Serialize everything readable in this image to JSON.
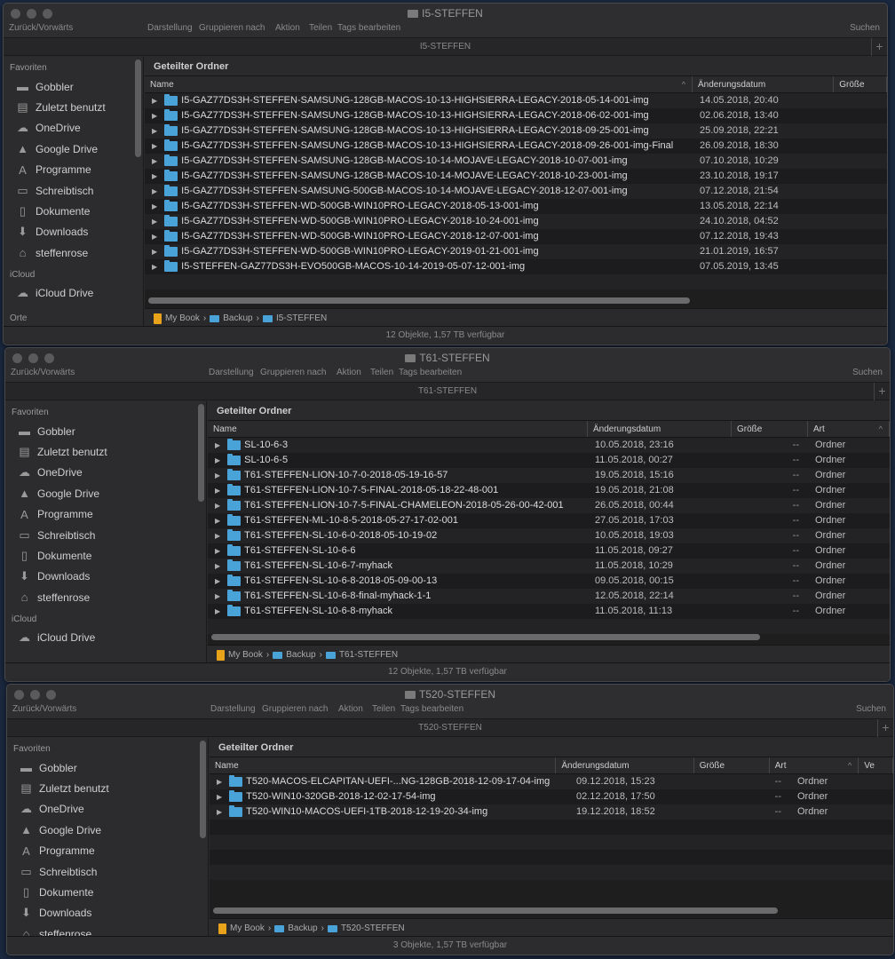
{
  "toolbar": {
    "back_forward": "Zurück/Vorwärts",
    "view": "Darstellung",
    "group": "Gruppieren nach",
    "action": "Aktion",
    "share": "Teilen",
    "tags": "Tags bearbeiten",
    "search": "Suchen"
  },
  "sidebar": {
    "favorites_label": "Favoriten",
    "items": [
      {
        "label": "Gobbler",
        "icon": "folder-icon"
      },
      {
        "label": "Zuletzt benutzt",
        "icon": "recents-icon"
      },
      {
        "label": "OneDrive",
        "icon": "cloud-icon"
      },
      {
        "label": "Google Drive",
        "icon": "google-drive-icon"
      },
      {
        "label": "Programme",
        "icon": "applications-icon"
      },
      {
        "label": "Schreibtisch",
        "icon": "desktop-icon"
      },
      {
        "label": "Dokumente",
        "icon": "documents-icon"
      },
      {
        "label": "Downloads",
        "icon": "downloads-icon"
      },
      {
        "label": "steffenrose",
        "icon": "home-icon"
      }
    ],
    "icloud_label": "iCloud",
    "icloud_drive": "iCloud Drive",
    "places_label": "Orte"
  },
  "columns": {
    "name": "Name",
    "date": "Änderungsdatum",
    "size": "Größe",
    "kind": "Art",
    "version": "Ve"
  },
  "group_header": "Geteilter Ordner",
  "colors": {
    "folder": "#4aa3d8",
    "drive": "#e8a31a",
    "desktop": "#1b2940"
  },
  "windows": [
    {
      "title": "I5-STEFFEN",
      "tab": "I5-STEFFEN",
      "path": [
        "My Book",
        "Backup",
        "I5-STEFFEN"
      ],
      "status": "12 Objekte, 1,57 TB verfügbar",
      "rows": [
        {
          "name": "I5-GAZ77DS3H-STEFFEN-SAMSUNG-128GB-MACOS-10-13-HIGHSIERRA-LEGACY-2018-05-14-001-img",
          "date": "14.05.2018, 20:40"
        },
        {
          "name": "I5-GAZ77DS3H-STEFFEN-SAMSUNG-128GB-MACOS-10-13-HIGHSIERRA-LEGACY-2018-06-02-001-img",
          "date": "02.06.2018, 13:40"
        },
        {
          "name": "I5-GAZ77DS3H-STEFFEN-SAMSUNG-128GB-MACOS-10-13-HIGHSIERRA-LEGACY-2018-09-25-001-img",
          "date": "25.09.2018, 22:21"
        },
        {
          "name": "I5-GAZ77DS3H-STEFFEN-SAMSUNG-128GB-MACOS-10-13-HIGHSIERRA-LEGACY-2018-09-26-001-img-Final",
          "date": "26.09.2018, 18:30"
        },
        {
          "name": "I5-GAZ77DS3H-STEFFEN-SAMSUNG-128GB-MACOS-10-14-MOJAVE-LEGACY-2018-10-07-001-img",
          "date": "07.10.2018, 10:29"
        },
        {
          "name": "I5-GAZ77DS3H-STEFFEN-SAMSUNG-128GB-MACOS-10-14-MOJAVE-LEGACY-2018-10-23-001-img",
          "date": "23.10.2018, 19:17"
        },
        {
          "name": "I5-GAZ77DS3H-STEFFEN-SAMSUNG-500GB-MACOS-10-14-MOJAVE-LEGACY-2018-12-07-001-img",
          "date": "07.12.2018, 21:54"
        },
        {
          "name": "I5-GAZ77DS3H-STEFFEN-WD-500GB-WIN10PRO-LEGACY-2018-05-13-001-img",
          "date": "13.05.2018, 22:14"
        },
        {
          "name": "I5-GAZ77DS3H-STEFFEN-WD-500GB-WIN10PRO-LEGACY-2018-10-24-001-img",
          "date": "24.10.2018, 04:52"
        },
        {
          "name": "I5-GAZ77DS3H-STEFFEN-WD-500GB-WIN10PRO-LEGACY-2018-12-07-001-img",
          "date": "07.12.2018, 19:43"
        },
        {
          "name": "I5-GAZ77DS3H-STEFFEN-WD-500GB-WIN10PRO-LEGACY-2019-01-21-001-img",
          "date": "21.01.2019, 16:57"
        },
        {
          "name": "I5-STEFFEN-GAZ77DS3H-EVO500GB-MACOS-10-14-2019-05-07-12-001-img",
          "date": "07.05.2019, 13:45"
        }
      ]
    },
    {
      "title": "T61-STEFFEN",
      "tab": "T61-STEFFEN",
      "path": [
        "My Book",
        "Backup",
        "T61-STEFFEN"
      ],
      "status": "12 Objekte, 1,57 TB verfügbar",
      "rows": [
        {
          "name": "SL-10-6-3",
          "date": "10.05.2018, 23:16",
          "size": "--",
          "kind": "Ordner"
        },
        {
          "name": "SL-10-6-5",
          "date": "11.05.2018, 00:27",
          "size": "--",
          "kind": "Ordner"
        },
        {
          "name": "T61-STEFFEN-LION-10-7-0-2018-05-19-16-57",
          "date": "19.05.2018, 15:16",
          "size": "--",
          "kind": "Ordner"
        },
        {
          "name": "T61-STEFFEN-LION-10-7-5-FINAL-2018-05-18-22-48-001",
          "date": "19.05.2018, 21:08",
          "size": "--",
          "kind": "Ordner"
        },
        {
          "name": "T61-STEFFEN-LION-10-7-5-FINAL-CHAMELEON-2018-05-26-00-42-001",
          "date": "26.05.2018, 00:44",
          "size": "--",
          "kind": "Ordner"
        },
        {
          "name": "T61-STEFFEN-ML-10-8-5-2018-05-27-17-02-001",
          "date": "27.05.2018, 17:03",
          "size": "--",
          "kind": "Ordner"
        },
        {
          "name": "T61-STEFFEN-SL-10-6-0-2018-05-10-19-02",
          "date": "10.05.2018, 19:03",
          "size": "--",
          "kind": "Ordner"
        },
        {
          "name": "T61-STEFFEN-SL-10-6-6",
          "date": "11.05.2018, 09:27",
          "size": "--",
          "kind": "Ordner"
        },
        {
          "name": "T61-STEFFEN-SL-10-6-7-myhack",
          "date": "11.05.2018, 10:29",
          "size": "--",
          "kind": "Ordner"
        },
        {
          "name": "T61-STEFFEN-SL-10-6-8-2018-05-09-00-13",
          "date": "09.05.2018, 00:15",
          "size": "--",
          "kind": "Ordner"
        },
        {
          "name": "T61-STEFFEN-SL-10-6-8-final-myhack-1-1",
          "date": "12.05.2018, 22:14",
          "size": "--",
          "kind": "Ordner"
        },
        {
          "name": "T61-STEFFEN-SL-10-6-8-myhack",
          "date": "11.05.2018, 11:13",
          "size": "--",
          "kind": "Ordner"
        }
      ]
    },
    {
      "title": "T520-STEFFEN",
      "tab": "T520-STEFFEN",
      "path": [
        "My Book",
        "Backup",
        "T520-STEFFEN"
      ],
      "status": "3 Objekte, 1,57 TB verfügbar",
      "rows": [
        {
          "name": "T520-MACOS-ELCAPITAN-UEFI-...NG-128GB-2018-12-09-17-04-img",
          "date": "09.12.2018, 15:23",
          "size": "--",
          "kind": "Ordner"
        },
        {
          "name": "T520-WIN10-320GB-2018-12-02-17-54-img",
          "date": "02.12.2018, 17:50",
          "size": "--",
          "kind": "Ordner"
        },
        {
          "name": "T520-WIN10-MACOS-UEFI-1TB-2018-12-19-20-34-img",
          "date": "19.12.2018, 18:52",
          "size": "--",
          "kind": "Ordner"
        }
      ]
    }
  ]
}
